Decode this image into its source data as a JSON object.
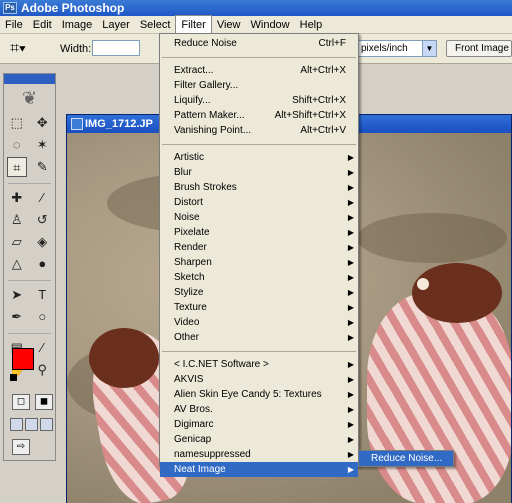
{
  "app": {
    "title": "Adobe Photoshop"
  },
  "menubar": {
    "items": [
      "File",
      "Edit",
      "Image",
      "Layer",
      "Select",
      "Filter",
      "View",
      "Window",
      "Help"
    ]
  },
  "options": {
    "width_label": "Width:",
    "units": "pixels/inch",
    "front_image": "Front Image"
  },
  "document": {
    "title": "IMG_1712.JP"
  },
  "colors": {
    "foreground": "#ff0000",
    "background": "#ffffff",
    "highlight": "#316ac5"
  },
  "filter_menu": {
    "top": {
      "label": "Reduce Noise",
      "shortcut": "Ctrl+F"
    },
    "group1": [
      {
        "label": "Extract...",
        "shortcut": "Alt+Ctrl+X"
      },
      {
        "label": "Filter Gallery...",
        "shortcut": ""
      },
      {
        "label": "Liquify...",
        "shortcut": "Shift+Ctrl+X"
      },
      {
        "label": "Pattern Maker...",
        "shortcut": "Alt+Shift+Ctrl+X"
      },
      {
        "label": "Vanishing Point...",
        "shortcut": "Alt+Ctrl+V"
      }
    ],
    "group2": [
      "Artistic",
      "Blur",
      "Brush Strokes",
      "Distort",
      "Noise",
      "Pixelate",
      "Render",
      "Sharpen",
      "Sketch",
      "Stylize",
      "Texture",
      "Video",
      "Other"
    ],
    "group3": [
      "< I.C.NET Software >",
      "AKVIS",
      "Alien Skin Eye Candy 5: Textures",
      "AV Bros.",
      "Digimarc",
      "Genicap",
      "namesuppressed",
      "Neat Image"
    ],
    "submenu": {
      "label": "Reduce Noise..."
    }
  }
}
